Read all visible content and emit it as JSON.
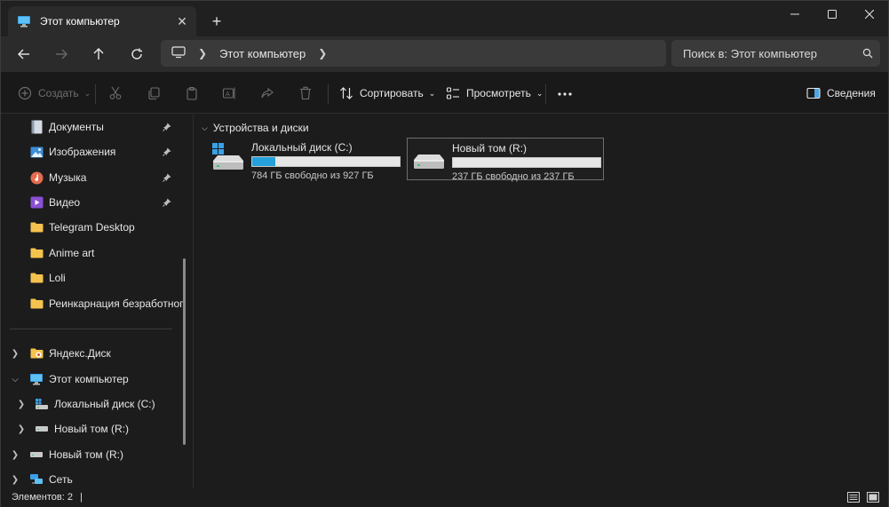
{
  "tab": {
    "title": "Этот компьютер",
    "close": "✕"
  },
  "address": {
    "segment": "Этот компьютер"
  },
  "search": {
    "placeholder": "Поиск в: Этот компьютер"
  },
  "commands": {
    "create": "Создать",
    "sort": "Сортировать",
    "view": "Просмотреть",
    "details": "Сведения"
  },
  "sidebar": {
    "items": [
      {
        "label": "Документы",
        "icon": "document-icon",
        "pinned": true
      },
      {
        "label": "Изображения",
        "icon": "pictures-icon",
        "pinned": true
      },
      {
        "label": "Музыка",
        "icon": "music-icon",
        "pinned": true
      },
      {
        "label": "Видео",
        "icon": "video-icon",
        "pinned": true
      },
      {
        "label": "Telegram Desktop",
        "icon": "folder-icon",
        "pinned": false
      },
      {
        "label": "Anime art",
        "icon": "folder-icon",
        "pinned": false
      },
      {
        "label": "Loli",
        "icon": "folder-icon",
        "pinned": false
      },
      {
        "label": "Реинкарнация безработного",
        "icon": "folder-icon",
        "pinned": false
      }
    ],
    "tree": [
      {
        "label": "Яндекс.Диск",
        "icon": "yandex-disk-icon",
        "expanded": false
      },
      {
        "label": "Этот компьютер",
        "icon": "computer-icon",
        "expanded": true
      },
      {
        "label": "Локальный диск (C:)",
        "icon": "system-drive-icon",
        "expanded": false
      },
      {
        "label": "Новый том (R:)",
        "icon": "drive-icon",
        "expanded": false
      },
      {
        "label": "Новый том (R:)",
        "icon": "drive-icon",
        "expanded": false
      },
      {
        "label": "Сеть",
        "icon": "network-icon",
        "expanded": false
      }
    ]
  },
  "content": {
    "group_title": "Устройства и диски",
    "drives": [
      {
        "name": "Локальный диск (C:)",
        "free_text": "784 ГБ свободно из 927 ГБ",
        "used_fraction": 0.154,
        "system": true
      },
      {
        "name": "Новый том (R:)",
        "free_text": "237 ГБ свободно из 237 ГБ",
        "used_fraction": 0.0,
        "system": false
      }
    ]
  },
  "status": {
    "items_count": "Элементов: 2",
    "caret": "|"
  },
  "colors": {
    "accent": "#26a0da",
    "background": "#1c1c1c",
    "folder": "#f4c34f"
  }
}
